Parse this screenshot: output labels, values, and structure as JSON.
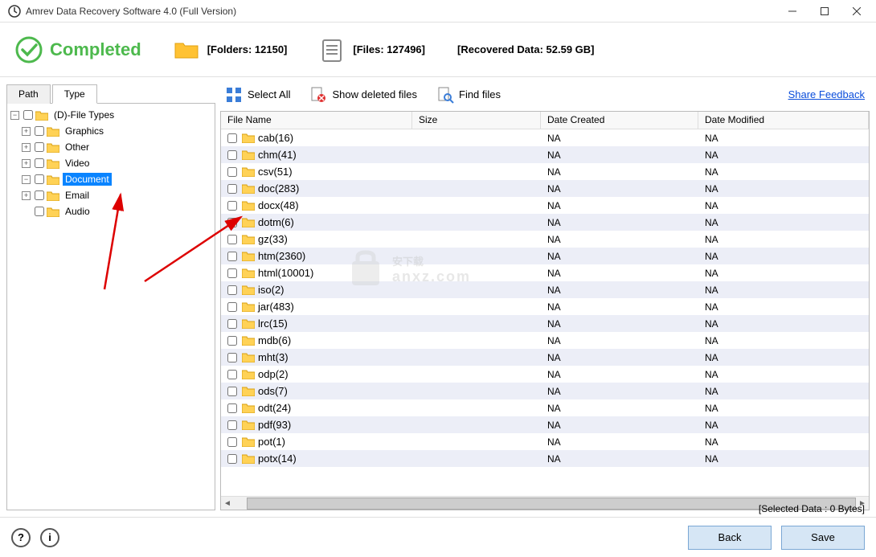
{
  "window": {
    "title": "Amrev Data Recovery Software 4.0 (Full Version)"
  },
  "header": {
    "completed_label": "Completed",
    "folders_label": "[Folders: 12150]",
    "files_label": "[Files: 127496]",
    "recovered_label": "[Recovered Data: 52.59 GB]"
  },
  "tabs": {
    "path": "Path",
    "type": "Type"
  },
  "tree": {
    "root": "(D)-File Types",
    "items": [
      {
        "label": "Graphics",
        "depth": 1,
        "expander": "+"
      },
      {
        "label": "Other",
        "depth": 1,
        "expander": "+"
      },
      {
        "label": "Video",
        "depth": 1,
        "expander": "+"
      },
      {
        "label": "Document",
        "depth": 1,
        "expander": "-",
        "selected": true
      },
      {
        "label": "Email",
        "depth": 1,
        "expander": "+"
      },
      {
        "label": "Audio",
        "depth": 1,
        "expander": ""
      }
    ]
  },
  "toolbar": {
    "select_all": "Select All",
    "show_deleted": "Show deleted files",
    "find_files": "Find files",
    "share_feedback": "Share Feedback"
  },
  "grid": {
    "columns": {
      "name": "File Name",
      "size": "Size",
      "created": "Date Created",
      "modified": "Date Modified"
    },
    "rows": [
      {
        "name": "cab(16)",
        "size": "",
        "created": "NA",
        "modified": "NA"
      },
      {
        "name": "chm(41)",
        "size": "",
        "created": "NA",
        "modified": "NA"
      },
      {
        "name": "csv(51)",
        "size": "",
        "created": "NA",
        "modified": "NA"
      },
      {
        "name": "doc(283)",
        "size": "",
        "created": "NA",
        "modified": "NA"
      },
      {
        "name": "docx(48)",
        "size": "",
        "created": "NA",
        "modified": "NA"
      },
      {
        "name": "dotm(6)",
        "size": "",
        "created": "NA",
        "modified": "NA"
      },
      {
        "name": "gz(33)",
        "size": "",
        "created": "NA",
        "modified": "NA"
      },
      {
        "name": "htm(2360)",
        "size": "",
        "created": "NA",
        "modified": "NA"
      },
      {
        "name": "html(10001)",
        "size": "",
        "created": "NA",
        "modified": "NA"
      },
      {
        "name": "iso(2)",
        "size": "",
        "created": "NA",
        "modified": "NA"
      },
      {
        "name": "jar(483)",
        "size": "",
        "created": "NA",
        "modified": "NA"
      },
      {
        "name": "lrc(15)",
        "size": "",
        "created": "NA",
        "modified": "NA"
      },
      {
        "name": "mdb(6)",
        "size": "",
        "created": "NA",
        "modified": "NA"
      },
      {
        "name": "mht(3)",
        "size": "",
        "created": "NA",
        "modified": "NA"
      },
      {
        "name": "odp(2)",
        "size": "",
        "created": "NA",
        "modified": "NA"
      },
      {
        "name": "ods(7)",
        "size": "",
        "created": "NA",
        "modified": "NA"
      },
      {
        "name": "odt(24)",
        "size": "",
        "created": "NA",
        "modified": "NA"
      },
      {
        "name": "pdf(93)",
        "size": "",
        "created": "NA",
        "modified": "NA"
      },
      {
        "name": "pot(1)",
        "size": "",
        "created": "NA",
        "modified": "NA"
      },
      {
        "name": "potx(14)",
        "size": "",
        "created": "NA",
        "modified": "NA"
      }
    ]
  },
  "footer": {
    "status": "[Selected Data : 0 Bytes]",
    "back": "Back",
    "save": "Save"
  },
  "watermark": {
    "main": "安下载",
    "sub": "anxz.com"
  }
}
